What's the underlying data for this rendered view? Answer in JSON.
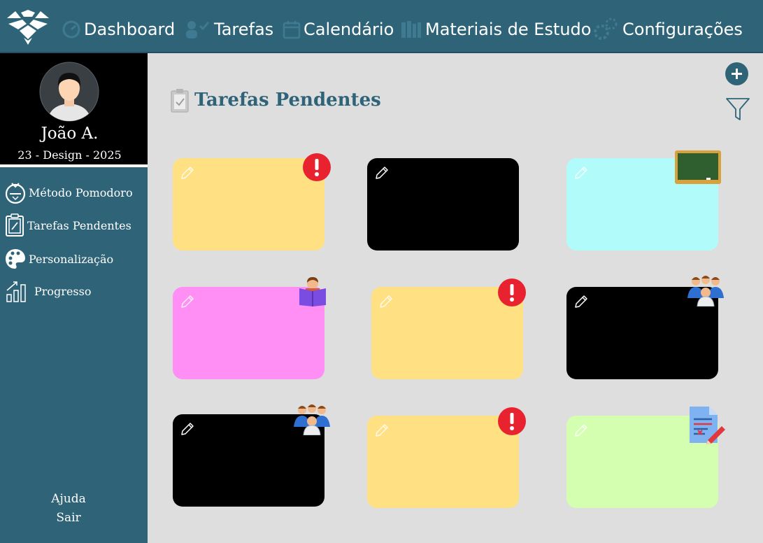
{
  "nav": {
    "items": [
      {
        "label": "Dashboard",
        "icon": "gauge-icon"
      },
      {
        "label": "Tarefas",
        "icon": "tasks-icon"
      },
      {
        "label": "Calendário",
        "icon": "calendar-icon"
      },
      {
        "label": "Materiais de Estudo",
        "icon": "books-icon"
      },
      {
        "label": "Configurações",
        "icon": "gears-icon"
      }
    ]
  },
  "profile": {
    "name": "João A.",
    "subtitle": "23 - Design - 2025"
  },
  "sidebar": {
    "items": [
      {
        "label": "Método Pomodoro",
        "icon": "tomato-timer-icon"
      },
      {
        "label": "Tarefas Pendentes",
        "icon": "clipboard-icon"
      },
      {
        "label": "Personalização",
        "icon": "palette-icon"
      },
      {
        "label": "Progresso",
        "icon": "bar-chart-icon"
      }
    ],
    "help_label": "Ajuda",
    "logout_label": "Sair"
  },
  "main": {
    "title": "Tarefas Pendentes"
  },
  "cards": [
    {
      "color": "#ffe082",
      "badge": "urgent-icon"
    },
    {
      "color": "#000000",
      "badge": ""
    },
    {
      "color": "#b2fbfb",
      "badge": "chalkboard-icon"
    },
    {
      "color": "#ff8ff4",
      "badge": "reading-icon"
    },
    {
      "color": "#ffe082",
      "badge": "urgent-icon"
    },
    {
      "color": "#000000",
      "badge": "group-icon"
    },
    {
      "color": "#000000",
      "badge": "group-icon"
    },
    {
      "color": "#ffe082",
      "badge": "urgent-icon"
    },
    {
      "color": "#d4ffb0",
      "badge": "document-edit-icon"
    }
  ],
  "colors": {
    "primary": "#2f6478",
    "background": "#dedede",
    "urgent": "#e8232f"
  }
}
